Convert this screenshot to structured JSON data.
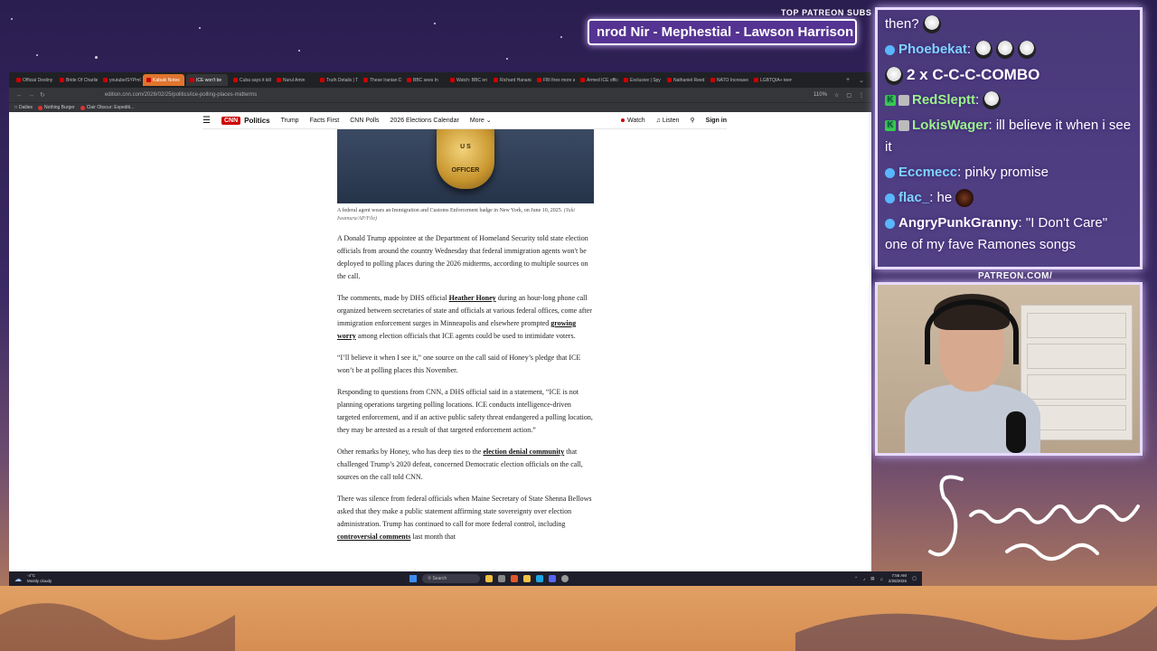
{
  "overlay": {
    "patreon_label": "TOP PATREON SUBS",
    "patreon_subs": "nrod Nir - Mephestial - Lawson Harrison -",
    "patreon_url": "PATREON.COM/",
    "colors": {
      "frame": "#e7dbff",
      "glow": "#cfb8ff",
      "username_blue": "#7fd4ff",
      "username_green": "#9cf28a"
    }
  },
  "browser": {
    "tabs": [
      {
        "label": "Official Destiny"
      },
      {
        "label": "Bride Of Charlie"
      },
      {
        "label": "youtube/SYPmC"
      },
      {
        "label": "Kabuki Notes"
      },
      {
        "label": "ICE won't be"
      },
      {
        "label": "Cuba says it kill"
      },
      {
        "label": "Nurul Amin"
      },
      {
        "label": "Truth Details | T"
      },
      {
        "label": "These Iranian Di"
      },
      {
        "label": "BBC sees In"
      },
      {
        "label": "Watch: BBC on c"
      },
      {
        "label": "Richard Hanania"
      },
      {
        "label": "FBI fires more a"
      },
      {
        "label": "Armed ICE offic"
      },
      {
        "label": "Exclusive | Spy n"
      },
      {
        "label": "Nathaniel Reed"
      },
      {
        "label": "NATO Increases"
      },
      {
        "label": "LGBTQIA+ teen"
      }
    ],
    "url": "edition.cnn.com/2026/02/25/politics/ice-polling-places-midterms",
    "zoom": "110%",
    "bookmarks": [
      "Dailies",
      "Nothing Burger",
      "Clair Obscur: Expediti..."
    ]
  },
  "cnn": {
    "logo": "CNN",
    "section": "Politics",
    "nav_items": [
      "Trump",
      "Facts First",
      "CNN Polls",
      "2026 Elections Calendar",
      "More"
    ],
    "watch": "Watch",
    "listen": "Listen",
    "signin": "Sign in",
    "badge_top": "U S",
    "badge_bottom": "OFFICER",
    "caption": "A federal agent wears an Immigration and Customs Enforcement badge in New York, on June 10, 2025.",
    "caption_credit": "(Yuki Iwamura/AP/File)",
    "p1": "A Donald Trump appointee at the Department of Homeland Security told state election officials from around the country Wednesday that federal immigration agents won't be deployed to polling places during the 2026 midterms, according to multiple sources on the call.",
    "p2_a": "The comments, made by DHS official ",
    "p2_link1": "Heather Honey",
    "p2_b": " during an hour-long phone call organized between secretaries of state and officials at various federal offices, come after immigration enforcement surges in Minneapolis and elsewhere prompted ",
    "p2_link2": "growing worry",
    "p2_c": " among election officials that ICE agents could be used to intimidate voters.",
    "p3": "“I’ll believe it when I see it,” one source on the call said of Honey’s pledge that ICE won’t be at polling places this November.",
    "p4": "Responding to questions from CNN, a DHS official said in a statement, “ICE is not planning operations targeting polling locations. ICE conducts intelligence-driven targeted enforcement, and if an active public safety threat endangered a polling location, they may be arrested as a result of that targeted enforcement action.”",
    "p5_a": "Other remarks by Honey, who has deep ties to the ",
    "p5_link": "election denial community",
    "p5_b": " that challenged Trump’s 2020 defeat, concerned Democratic election officials on the call, sources on the call told CNN.",
    "p6_a": "There was silence from federal officials when Maine Secretary of State Shenna Bellows asked that they make a public statement affirming state sovereignty over election administration. Trump has continued to call for more federal control, including ",
    "p6_link": "controversial comments",
    "p6_b": " last month that"
  },
  "taskbar": {
    "temp": "-4°C",
    "weather": "Mostly cloudy",
    "search": "Search",
    "time": "7:56 AM",
    "date": "2/26/2026"
  },
  "chat": {
    "messages": [
      {
        "user": "",
        "text": "then?",
        "emote": "face"
      },
      {
        "user": "Phoebekat",
        "text": "",
        "emote": "faces3"
      },
      {
        "combo": "2 x C-C-C-COMBO"
      },
      {
        "user": "RedSleptt",
        "text": "",
        "emote": "face"
      },
      {
        "user": "LokisWager",
        "text": "ill believe it when i see it"
      },
      {
        "user": "Eccmecc",
        "text": "pinky promise"
      },
      {
        "user": "flac_",
        "text": "he",
        "emote": "dark"
      },
      {
        "user": "AngryPunkGranny",
        "text": "\"I Don't Care\" one of my fave Ramones songs"
      }
    ]
  }
}
